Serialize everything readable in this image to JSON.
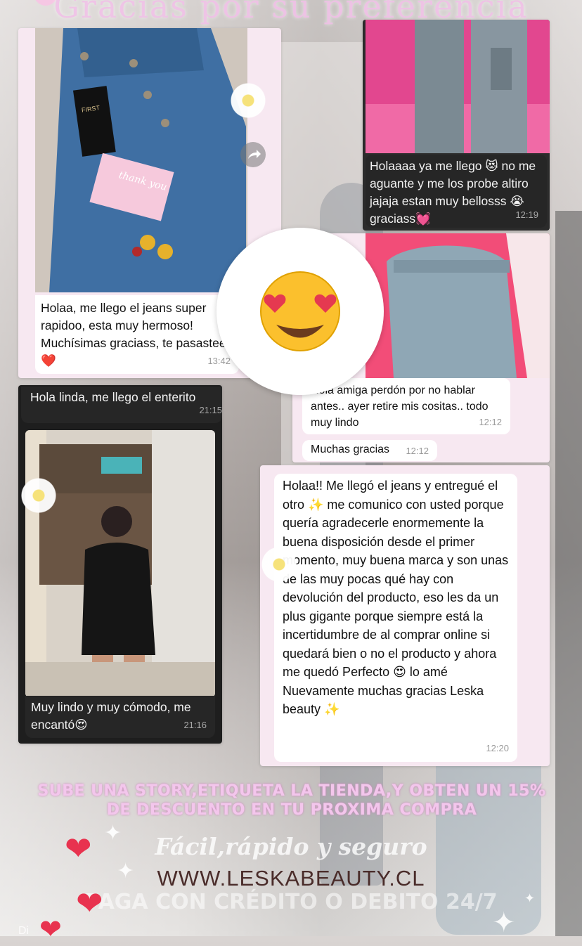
{
  "title": "Gracias por su preferencia",
  "messages": {
    "m1": {
      "text": "Holaa, me llego el jeans super rapidoo, esta muy hermoso! Muchísimas graciass, te pasastee❤️",
      "time": "13:42"
    },
    "m2": {
      "text": "Holaaaa ya me llego 😻 no me aguante y me los probe altiro jajaja estan muy bellosss 😭 graciass💓",
      "time": "12:19"
    },
    "m3": {
      "text": "Hola amiga perdón por no hablar antes.. ayer retire mis cositas.. todo muy lindo",
      "time": "12:12"
    },
    "m4": {
      "text": "Muchas gracias",
      "time": "12:12"
    },
    "m5": {
      "text": "Hola linda, me llego el enterito",
      "time": "21:15"
    },
    "m6": {
      "text": "Muy lindo y muy cómodo, me encantó😍",
      "time": "21:16"
    },
    "m7": {
      "text": "Holaa!! Me llegó el jeans y entregué el otro ✨ me comunico con usted porque quería agradecerle enormemente la buena disposición desde el primer momento, muy buena marca y son unas de las muy pocas qué hay con devolución del producto, eso les da un plus gigante porque siempre está la incertidumbre de al comprar online si  quedará bien o no el producto y ahora me quedó Perfecto 😍 lo amé Nuevamente muchas gracias Leska beauty ✨",
      "time": "12:20"
    }
  },
  "emoji_sticker": "😍",
  "thank_you_card": "thank you",
  "tag_label": "FIRST",
  "promo": "SUBE UNA STORY,ETIQUETA LA TIENDA,Y OBTEN UN 15% DE DESCUENTO EN TU PROXIMA COMPRA",
  "slogan": "Fácil,rápido y seguro",
  "url": "WWW.LESKABEAUTY.CL",
  "payment": "PAGA CON CRÉDITO O DEBITO 24/7",
  "bottom_left": "Di",
  "icons": {
    "share": "share-arrow-icon",
    "heart": "heart-icon",
    "sparkle": "sparkle-icon"
  },
  "colors": {
    "heart": "#e8334f",
    "promo": "#f3c6ec",
    "card_bg": "#f7e8f1",
    "url": "#4a2c2a"
  }
}
